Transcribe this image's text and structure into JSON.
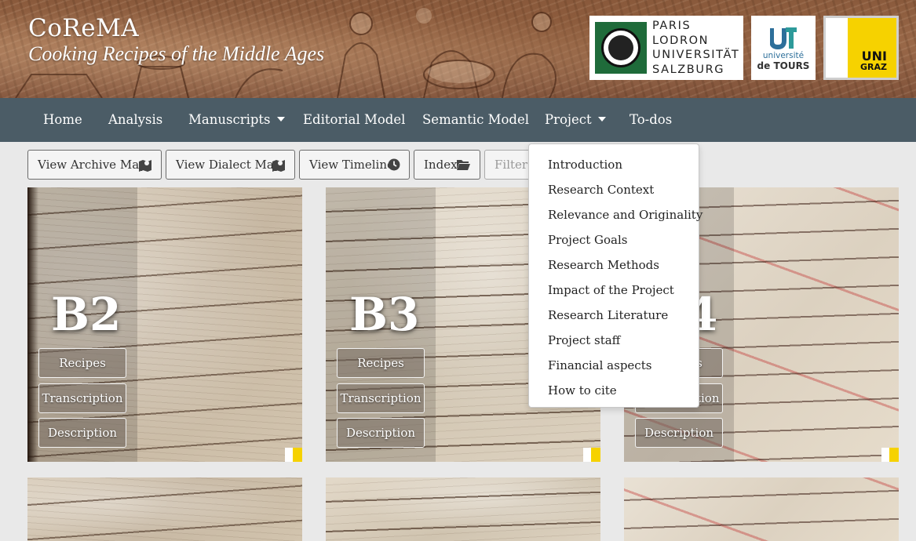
{
  "header": {
    "title": "CoReMA",
    "subtitle": "Cooking Recipes of the Middle Ages",
    "logos": {
      "plus": {
        "lines": [
          "PARIS",
          "LODRON",
          "UNIVERSITÄT",
          "SALZBURG"
        ]
      },
      "tours": {
        "line1": "université",
        "line2": "de TOURS"
      },
      "graz": {
        "line1": "UNI",
        "line2": "GRAZ"
      }
    }
  },
  "nav": {
    "items": [
      "Home",
      "Analysis",
      "Manuscripts",
      "Editorial Model",
      "Semantic Model",
      "Project",
      "To-dos"
    ]
  },
  "toolbar": {
    "archive_map": "View Archive Map",
    "dialect_map": "View Dialect Map",
    "timeline": "View Timeline",
    "index": "Index",
    "filter_placeholder": "Filter Archive Map"
  },
  "dropdown": {
    "items": [
      "Introduction",
      "Research Context",
      "Relevance and Originality",
      "Project Goals",
      "Research Methods",
      "Impact of the Project",
      "Research Literature",
      "Project staff",
      "Financial aspects",
      "How to cite"
    ]
  },
  "cards": [
    {
      "label": "B2",
      "buttons": [
        "Recipes",
        "Transcription",
        "Description"
      ]
    },
    {
      "label": "B3",
      "buttons": [
        "Recipes",
        "Transcription",
        "Description"
      ]
    },
    {
      "label": "B4",
      "buttons": [
        "Recipes",
        "Transcription",
        "Description"
      ]
    }
  ],
  "colors": {
    "navbar": "#4b5c66",
    "banner": "#8a5a3c",
    "graz_yellow": "#f6d200",
    "plus_green": "#1f6b3a"
  }
}
